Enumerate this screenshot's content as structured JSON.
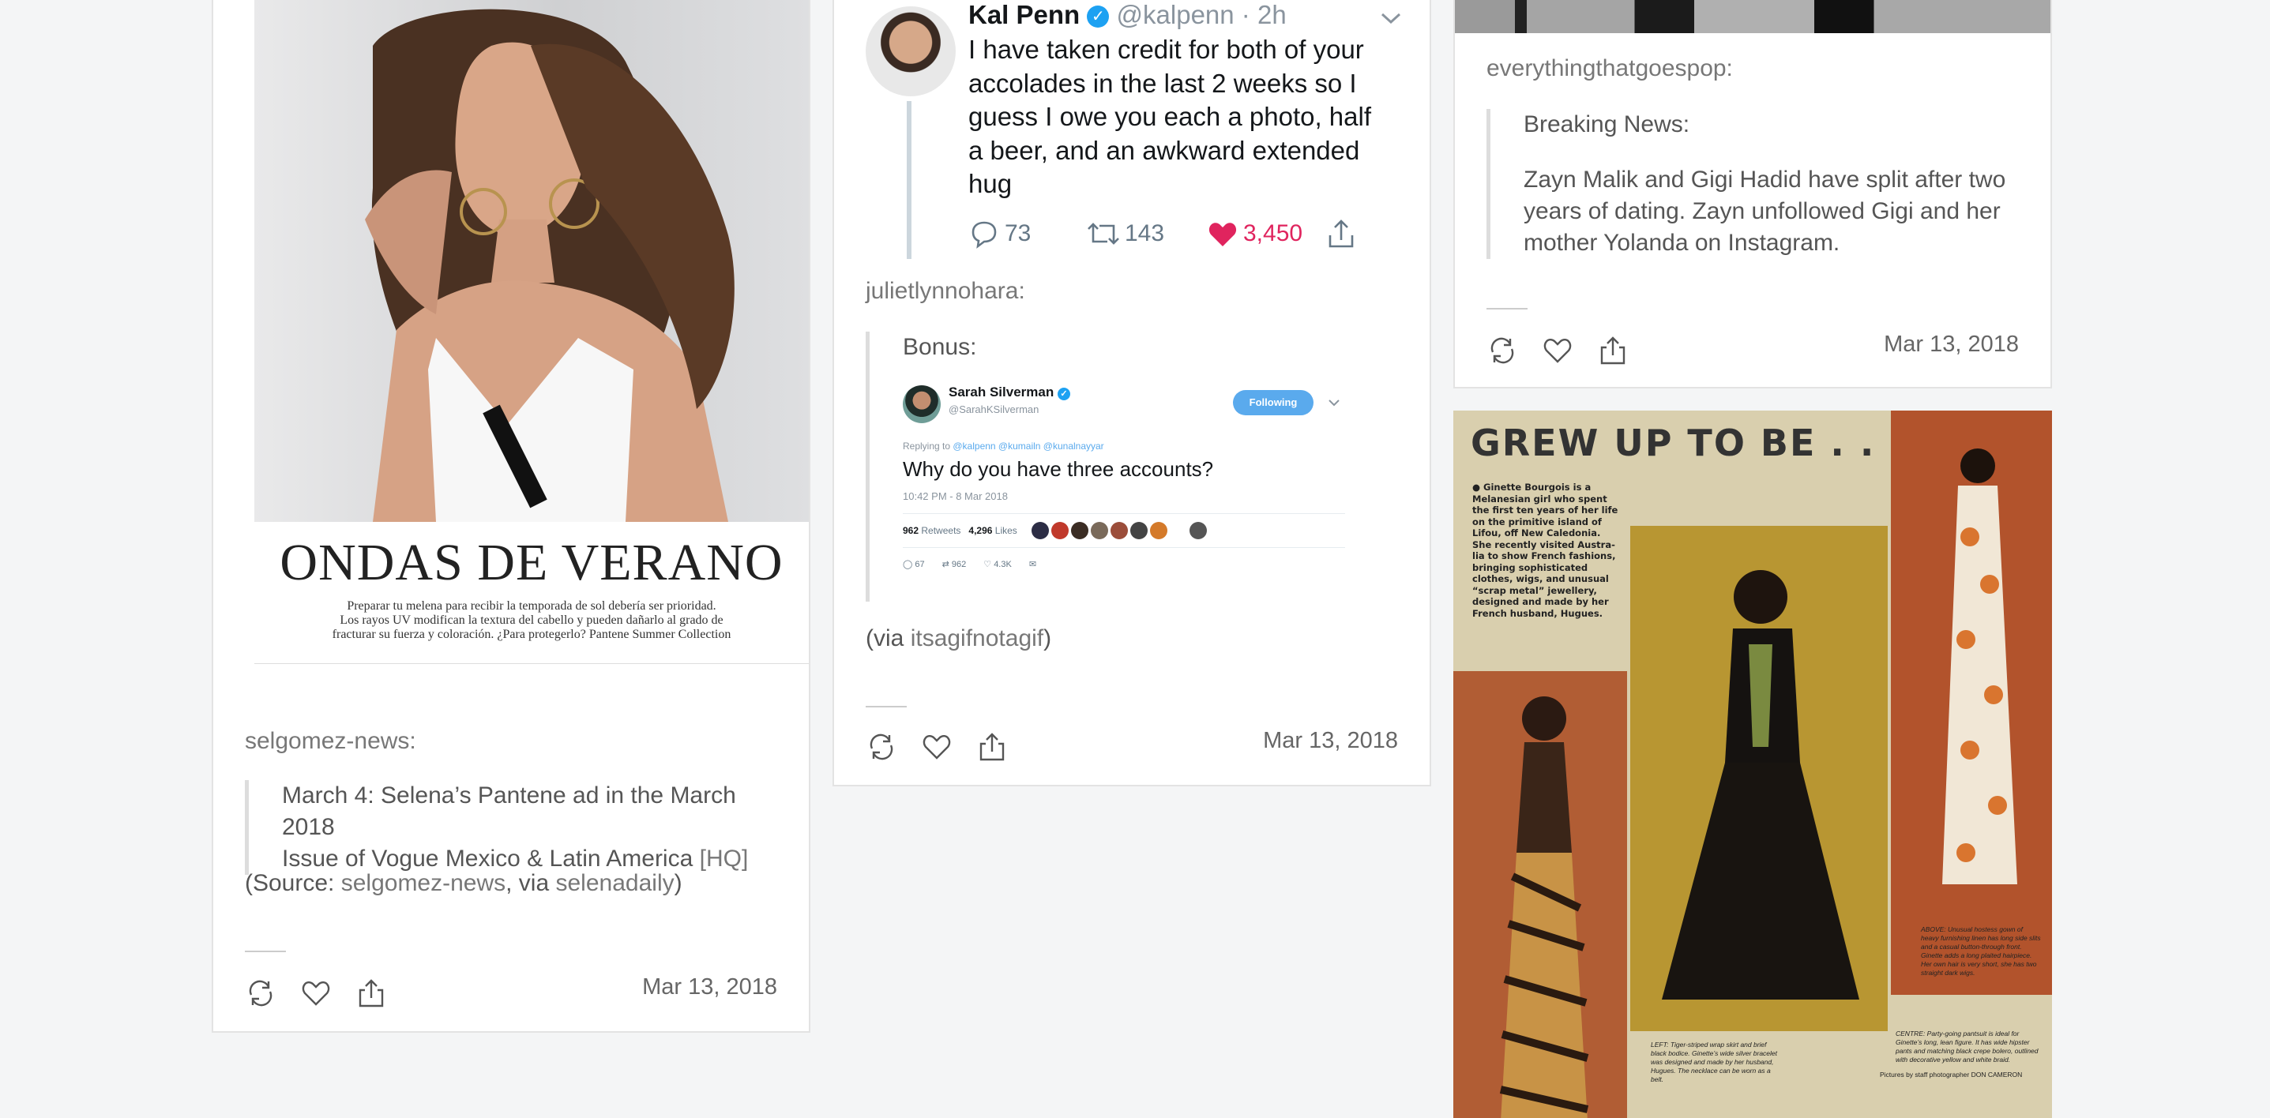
{
  "colors": {
    "accent_like": "#e0245e",
    "twitter_blue": "#1da1f2",
    "page_bg": "#f4f5f6"
  },
  "left_post": {
    "magazine_headline": "ONDAS DE VERANO",
    "magazine_caption_1": "Preparar tu melena para recibir la temporada de sol debería ser prioridad.",
    "magazine_caption_2": "Los rayos UV modifican la textura del cabello y pueden dañarlo al grado de",
    "magazine_caption_3": "fracturar su fuerza y coloración. ¿Para protegerlo? Pantene Summer Collection",
    "blog_name": "selgomez-news:",
    "quote_line_1": "March 4: Selena’s Pantene ad in the March 2018",
    "quote_line_2": "Issue of Vogue Mexico & Latin America",
    "quote_link": "[HQ]",
    "source_prefix": "(Source: ",
    "source_link": "selgomez-news",
    "via_text": ", via ",
    "via_link": "selenadaily",
    "source_suffix": ")",
    "date": "Mar 13, 2018"
  },
  "middle_post": {
    "tweet": {
      "author": "Kal Penn",
      "handle": "@kalpenn · 2h",
      "text_1": "I have taken credit for both of your",
      "text_2": "accolades in the last 2 weeks so I",
      "text_3": "guess I owe you each a photo, half",
      "text_4": "a beer, and an awkward extended",
      "text_5": "hug",
      "replies": "73",
      "retweets": "143",
      "likes": "3,450"
    },
    "blog_name": "julietlynnohara:",
    "quote_text": "Bonus:",
    "embedded_tweet": {
      "author": "Sarah Silverman",
      "handle": "@SarahKSilverman",
      "follow_label": "Following",
      "replying_prefix": "Replying to ",
      "replying_to": "@kalpenn @kumailn @kunalnayyar",
      "text": "Why do you have three accounts?",
      "timestamp": "10:42 PM - 8 Mar 2018",
      "retweets_count": "962",
      "retweets_label": "Retweets",
      "likes_count": "4,296",
      "likes_label": "Likes",
      "reply_count": "67",
      "rt_count": "962",
      "like_count": "4.3K"
    },
    "via_prefix": "(via ",
    "via_link": "itsagifnotagif",
    "via_suffix": ")",
    "date": "Mar 13, 2018"
  },
  "right_top_post": {
    "blog_name": "everythingthatgoespop:",
    "quote_line_1": "Breaking News:",
    "quote_line_2": "Zayn Malik and Gigi Hadid have split after two",
    "quote_line_3": "years of dating. Zayn unfollowed Gigi and her",
    "quote_line_4": "mother Yolanda on Instagram.",
    "date": "Mar 13, 2018"
  },
  "right_bottom_post": {
    "headline": "GREW UP TO BE . . .",
    "body_1": "● Ginette Bourgois is a",
    "body_2": "Melanesian girl who spent",
    "body_3": "the first ten years of her life",
    "body_4": "on the primitive island of",
    "body_5": "Lifou, off New Caledonia.",
    "body_6": "She recently visited Austra-",
    "body_7": "lia to show French fashions,",
    "body_8": "bringing sophisticated",
    "body_9": "clothes, wigs, and unusual",
    "body_10": "“scrap metal” jewellery,",
    "body_11": "designed and made by her",
    "body_12": "French husband, Hugues.",
    "caption_left": "LEFT: Tiger-striped wrap skirt and brief black bodice. Ginette’s wide silver bracelet was designed and made by her husband, Hugues. The necklace can be worn as a belt.",
    "caption_above": "ABOVE: Unusual hostess gown of heavy furnishing linen has long side slits and a casual button-through front. Ginette adds a long plaited hairpiece. Her own hair is very short, she has two straight dark wigs.",
    "caption_centre": "CENTRE: Party-going pantsuit is ideal for Ginette’s long, lean figure. It has wide hipster pants and matching black crepe bolero, outlined with decorative yellow and white braid.",
    "credit": "Pictures by staff photographer DON CAMERON"
  }
}
